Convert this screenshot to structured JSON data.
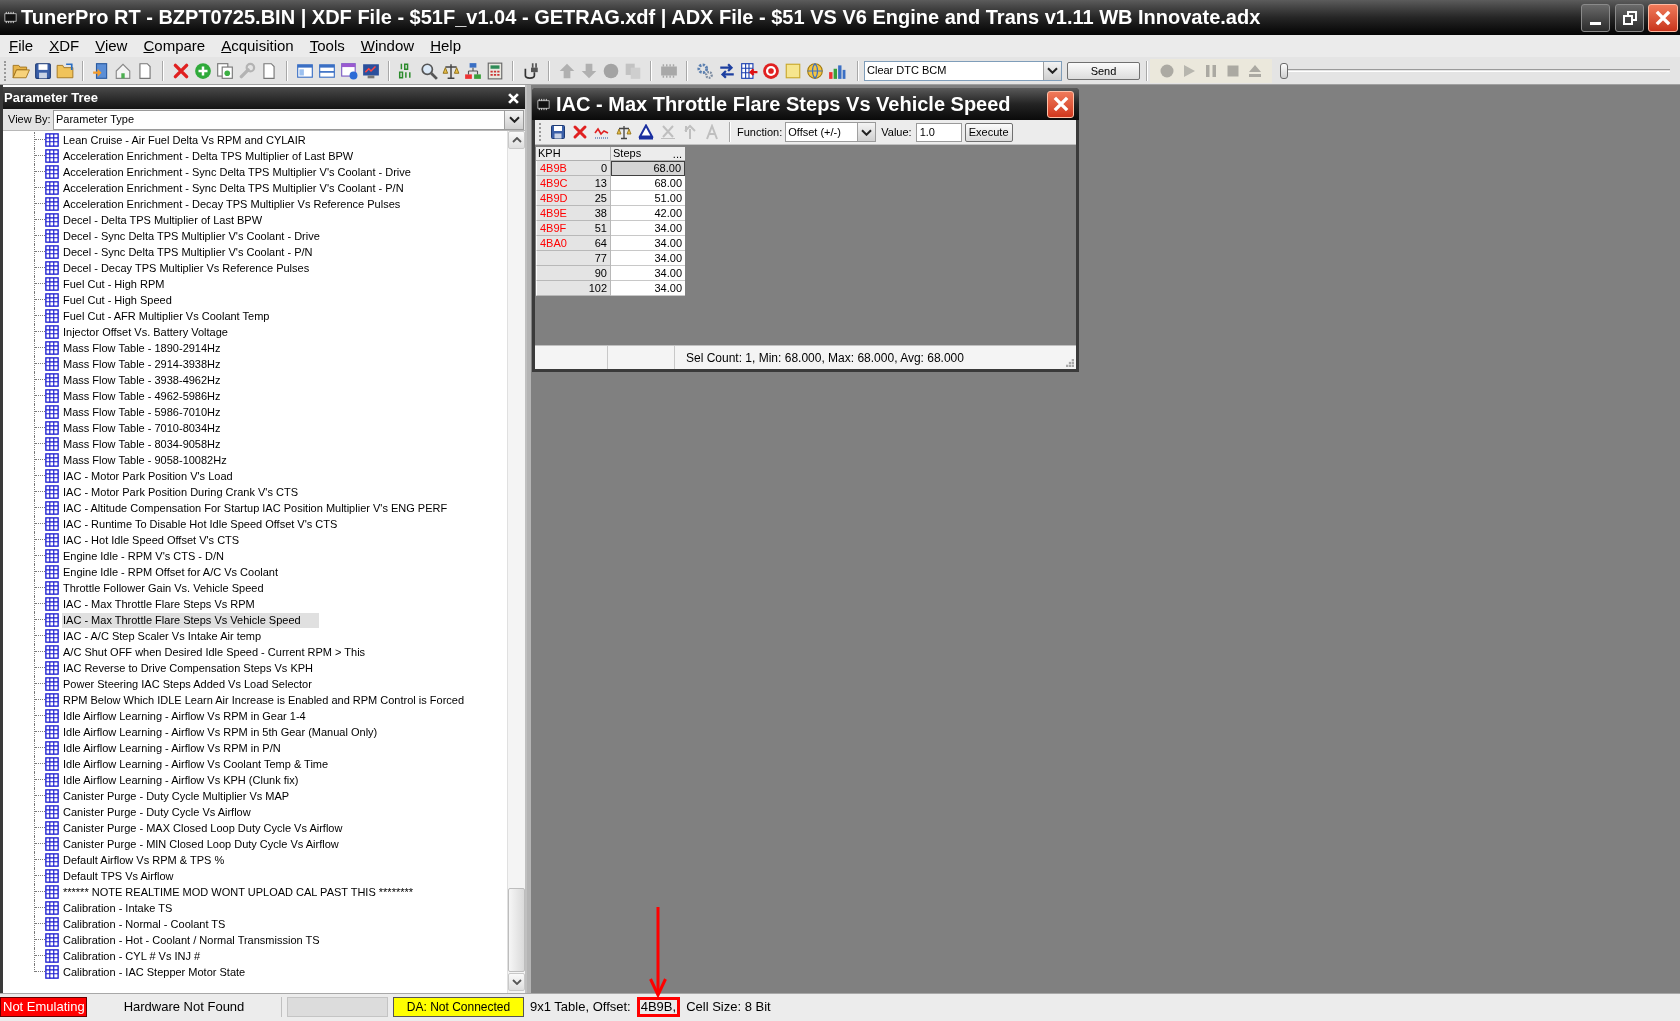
{
  "window": {
    "title": "TunerPro RT - BZPT0725.BIN | XDF File - $51F_v1.04 - GETRAG.xdf | ADX File - $51 VS V6 Engine and Trans v1.11 WB Innovate.adx"
  },
  "menu": [
    "File",
    "XDF",
    "View",
    "Compare",
    "Acquisition",
    "Tools",
    "Window",
    "Help"
  ],
  "toolbar": {
    "groups": [
      [
        {
          "disabled": false
        },
        {
          "disabled": false
        },
        {
          "disabled": false
        }
      ],
      [
        {
          "disabled": false
        },
        {
          "disabled": false
        },
        {
          "disabled": false
        }
      ],
      [
        {
          "disabled": false
        },
        {
          "disabled": false
        },
        {
          "disabled": false
        },
        {
          "disabled": true
        },
        {
          "disabled": false
        }
      ],
      [
        {
          "disabled": false
        },
        {
          "disabled": false
        },
        {
          "disabled": false
        },
        {
          "disabled": false
        }
      ],
      [
        {
          "disabled": false
        },
        {
          "disabled": false
        },
        {
          "disabled": false
        },
        {
          "disabled": false
        },
        {
          "disabled": false
        }
      ],
      [
        {
          "disabled": false
        }
      ],
      [
        {
          "disabled": true
        },
        {
          "disabled": true
        },
        {
          "disabled": true
        },
        {
          "disabled": true
        }
      ],
      [
        {
          "disabled": true
        }
      ],
      [
        {
          "disabled": false
        },
        {
          "disabled": false
        },
        {
          "disabled": false
        },
        {
          "disabled": false
        },
        {
          "disabled": false
        },
        {
          "disabled": false
        },
        {
          "disabled": false
        }
      ]
    ],
    "command": {
      "value": "Clear DTC BCM"
    },
    "send_button": "Send",
    "playback": [
      {
        "disabled": true
      },
      {
        "disabled": true
      },
      {
        "disabled": true
      },
      {
        "disabled": true
      },
      {
        "disabled": true
      }
    ],
    "position_slider": {
      "level": 0
    }
  },
  "parameter_tree": {
    "title": "Parameter Tree",
    "view_by": {
      "label": "View By:",
      "value": "Parameter Type"
    },
    "items": [
      {
        "label": "Lean Cruise - Air Fuel Delta Vs RPM and CYLAIR",
        "selected": false
      },
      {
        "label": "Acceleration Enrichment - Delta TPS Multiplier of Last BPW",
        "selected": false
      },
      {
        "label": "Acceleration Enrichment - Sync Delta TPS Multiplier V's Coolant - Drive",
        "selected": false
      },
      {
        "label": "Acceleration Enrichment - Sync Delta TPS Multiplier V's Coolant - P/N",
        "selected": false
      },
      {
        "label": "Acceleration Enrichment - Decay TPS Multiplier Vs Reference Pulses",
        "selected": false
      },
      {
        "label": "Decel - Delta TPS Multiplier of Last BPW",
        "selected": false
      },
      {
        "label": "Decel - Sync Delta TPS Multiplier V's Coolant - Drive",
        "selected": false
      },
      {
        "label": "Decel - Sync Delta TPS Multiplier V's Coolant - P/N",
        "selected": false
      },
      {
        "label": "Decel - Decay TPS Multiplier Vs Reference Pulses",
        "selected": false
      },
      {
        "label": "Fuel Cut - High RPM",
        "selected": false
      },
      {
        "label": "Fuel Cut - High Speed",
        "selected": false
      },
      {
        "label": "Fuel Cut - AFR Multiplier Vs Coolant Temp",
        "selected": false
      },
      {
        "label": "Injector Offset Vs. Battery Voltage",
        "selected": false
      },
      {
        "label": "Mass Flow Table - 1890-2914Hz",
        "selected": false
      },
      {
        "label": "Mass Flow Table - 2914-3938Hz",
        "selected": false
      },
      {
        "label": "Mass Flow Table - 3938-4962Hz",
        "selected": false
      },
      {
        "label": "Mass Flow Table - 4962-5986Hz",
        "selected": false
      },
      {
        "label": "Mass Flow Table - 5986-7010Hz",
        "selected": false
      },
      {
        "label": "Mass Flow Table - 7010-8034Hz",
        "selected": false
      },
      {
        "label": "Mass Flow Table - 8034-9058Hz",
        "selected": false
      },
      {
        "label": "Mass Flow Table - 9058-10082Hz",
        "selected": false
      },
      {
        "label": "IAC - Motor Park Position V's Load",
        "selected": false
      },
      {
        "label": "IAC - Motor Park Position During Crank V's CTS",
        "selected": false
      },
      {
        "label": "IAC - Altitude Compensation For Startup IAC Position Multiplier V's ENG PERF",
        "selected": false
      },
      {
        "label": "IAC - Runtime To Disable Hot Idle Speed Offset V's CTS",
        "selected": false
      },
      {
        "label": "IAC - Hot Idle Speed Offset V's CTS",
        "selected": false
      },
      {
        "label": "Engine Idle - RPM V's CTS - D/N",
        "selected": false
      },
      {
        "label": "Engine Idle - RPM Offset for A/C Vs Coolant",
        "selected": false
      },
      {
        "label": "Throttle Follower Gain Vs. Vehicle Speed",
        "selected": false
      },
      {
        "label": "IAC - Max Throttle Flare Steps Vs RPM",
        "selected": false
      },
      {
        "label": "IAC - Max Throttle Flare Steps Vs Vehicle Speed",
        "selected": true
      },
      {
        "label": "IAC - A/C Step Scaler Vs Intake Air temp",
        "selected": false
      },
      {
        "label": "A/C Shut OFF when Desired Idle Speed - Current RPM > This",
        "selected": false
      },
      {
        "label": "IAC Reverse to Drive Compensation Steps Vs KPH",
        "selected": false
      },
      {
        "label": "Power Steering IAC Steps Added Vs Load Selector",
        "selected": false
      },
      {
        "label": "RPM Below Which IDLE Learn Air Increase is Enabled and RPM Control is Forced",
        "selected": false
      },
      {
        "label": "Idle Airflow Learning - Airflow Vs RPM in Gear 1-4",
        "selected": false
      },
      {
        "label": "Idle Airflow Learning - Airflow Vs RPM in 5th Gear (Manual Only)",
        "selected": false
      },
      {
        "label": "Idle Airflow Learning - Airflow Vs RPM in P/N",
        "selected": false
      },
      {
        "label": "Idle Airflow Learning - Airflow Vs Coolant Temp & Time",
        "selected": false
      },
      {
        "label": "Idle Airflow Learning - Airflow Vs KPH (Clunk fix)",
        "selected": false
      },
      {
        "label": "Canister Purge - Duty Cycle Multiplier Vs MAP",
        "selected": false
      },
      {
        "label": "Canister Purge - Duty Cycle Vs Airflow",
        "selected": false
      },
      {
        "label": "Canister Purge - MAX Closed Loop Duty Cycle Vs Airflow",
        "selected": false
      },
      {
        "label": "Canister Purge - MIN Closed Loop Duty Cycle Vs Airflow",
        "selected": false
      },
      {
        "label": "Default Airflow Vs RPM & TPS %",
        "selected": false
      },
      {
        "label": "Default TPS Vs Airflow",
        "selected": false
      },
      {
        "label": "****** NOTE REALTIME MOD WONT UPLOAD CAL PAST THIS ********",
        "selected": false
      },
      {
        "label": "Calibration - Intake TS",
        "selected": false
      },
      {
        "label": "Calibration - Normal - Coolant TS",
        "selected": false
      },
      {
        "label": "Calibration - Hot - Coolant / Normal Transmission TS",
        "selected": false
      },
      {
        "label": "Calibration - CYL # Vs INJ #",
        "selected": false
      },
      {
        "label": "Calibration - IAC Stepper Motor State",
        "selected": false
      }
    ]
  },
  "table_window": {
    "title": "IAC - Max Throttle Flare Steps Vs Vehicle Speed",
    "tools": [
      {
        "disabled": false
      },
      {
        "disabled": false
      },
      {
        "disabled": false
      },
      {
        "disabled": false
      },
      {
        "disabled": false
      },
      {
        "disabled": true
      },
      {
        "disabled": true
      },
      {
        "disabled": true
      }
    ],
    "function": {
      "label": "Function:",
      "value": "Offset (+/-)"
    },
    "value": {
      "label": "Value:",
      "value": "1.0"
    },
    "execute_button": "Execute",
    "columns": [
      "KPH",
      "Steps"
    ],
    "header_button": "...",
    "rows": [
      {
        "address": "4B9B",
        "kph": "0",
        "steps": "68.00",
        "selected": true
      },
      {
        "address": "4B9C",
        "kph": "13",
        "steps": "68.00",
        "selected": false
      },
      {
        "address": "4B9D",
        "kph": "25",
        "steps": "51.00",
        "selected": false
      },
      {
        "address": "4B9E",
        "kph": "38",
        "steps": "42.00",
        "selected": false
      },
      {
        "address": "4B9F",
        "kph": "51",
        "steps": "34.00",
        "selected": false
      },
      {
        "address": "4BA0",
        "kph": "64",
        "steps": "34.00",
        "selected": false
      },
      {
        "kph": "77",
        "steps": "34.00",
        "selected": false
      },
      {
        "kph": "90",
        "steps": "34.00",
        "selected": false
      },
      {
        "kph": "102",
        "steps": "34.00",
        "selected": false
      }
    ],
    "status": "Sel Count: 1, Min: 68.000, Max: 68.000, Avg: 68.000"
  },
  "status_bar": {
    "items": [
      {
        "kind": "error",
        "text": "Not Emulating"
      },
      {
        "kind": "plain",
        "text": "Hardware Not Found"
      },
      {
        "kind": "panel"
      },
      {
        "kind": "warning",
        "text": "DA: Not Connected"
      },
      {
        "kind": "inline",
        "text": "9x1 Table, Offset:"
      },
      {
        "kind": "inline",
        "text": "4B9B,",
        "highlighted": true
      },
      {
        "kind": "inline",
        "text": "Cell Size: 8 Bit"
      }
    ]
  }
}
